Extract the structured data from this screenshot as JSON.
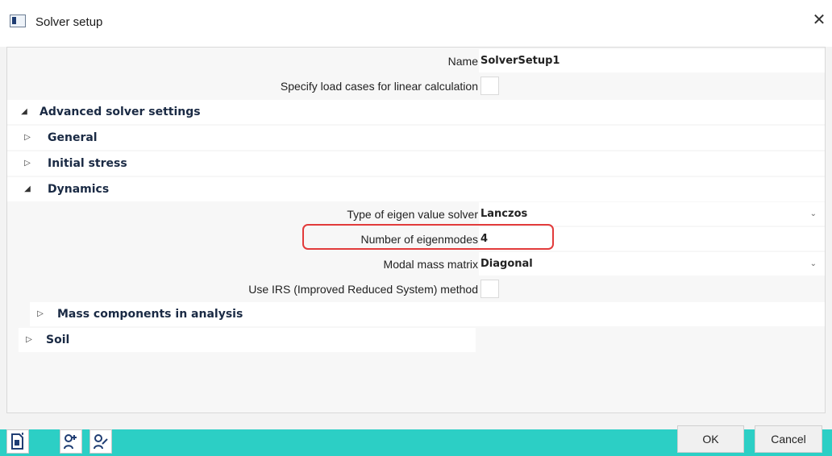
{
  "window": {
    "title": "Solver setup"
  },
  "properties": {
    "name": {
      "label": "Name",
      "value": "SolverSetup1"
    },
    "load_cases": {
      "label": "Specify load cases for linear calculation"
    }
  },
  "sections": {
    "advanced": "Advanced solver settings",
    "general": "General",
    "initial_stress": "Initial stress",
    "dynamics": "Dynamics",
    "mass_components": "Mass components in analysis",
    "soil": "Soil"
  },
  "dynamics": {
    "eigen_solver": {
      "label": "Type of eigen value solver",
      "value": "Lanczos"
    },
    "eigenmodes": {
      "label": "Number of eigenmodes",
      "value": "4"
    },
    "modal_mass": {
      "label": "Modal mass matrix",
      "value": "Diagonal"
    },
    "irs": {
      "label": "Use IRS (Improved Reduced System) method"
    }
  },
  "icons": {
    "expanded": "◢",
    "collapsed": "▷",
    "dropdown": "⌄",
    "close": "✕"
  },
  "buttons": {
    "ok": "OK",
    "cancel": "Cancel"
  },
  "colors": {
    "accent_bar": "#2ccfc5",
    "highlight": "#e23b3b",
    "toolbar_icon": "#1f3d73"
  }
}
